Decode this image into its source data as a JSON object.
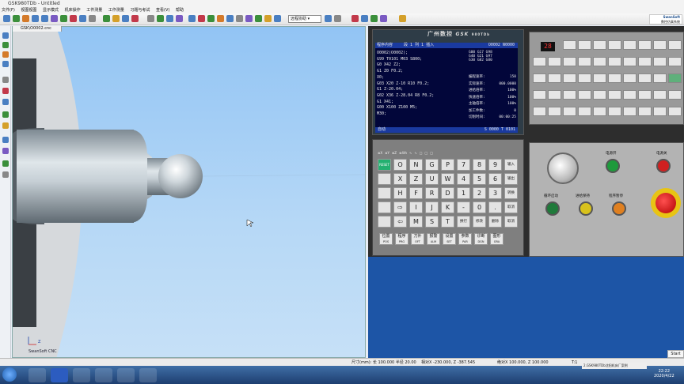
{
  "window": {
    "title": "GSK980TDb - Untitled"
  },
  "menu": [
    "文件(F)",
    "视图视图",
    "显示模式",
    "机床操作",
    "工件测量",
    "工作测量",
    "习题与考试",
    "查看(V)",
    "帮助"
  ],
  "toolbar": {
    "mode_select": "远程协助"
  },
  "viewport": {
    "tab_label": "GSK\\O0002.cnc",
    "watermark": "SwanSoft CNC",
    "axis_z": "Z",
    "axis_x": "X"
  },
  "cnc": {
    "brand_cn": "广州数控",
    "brand_en": "GSK",
    "model": "980TDb",
    "screen": {
      "header": "程序内容",
      "section": "段 1  列 1  插入",
      "program_no": "O0002 N0000",
      "lines": [
        "O0002(O0002);",
        "G99 T0101 M03 S800;",
        "G0 X42 Z2;",
        "G1 Z0 F0.2;",
        "X0;",
        "G03 X20 Z-10 R10 F0.2;",
        "G1 Z-20.04;",
        "G02 X36 Z-28.04 R8 F0.2;",
        "G1 X41;",
        "G00 X100 Z100 M5;",
        "M30;"
      ],
      "right_top": [
        "G00 G17 G98",
        "G40 G21 G97",
        "G30 G82 G80"
      ],
      "stats": [
        {
          "label": "编程速率:",
          "value": "150"
        },
        {
          "label": "实际速率:",
          "value": "000.0000"
        },
        {
          "label": "进给倍率:",
          "value": "100%"
        },
        {
          "label": "快速倍率:",
          "value": "100%"
        },
        {
          "label": "主轴倍率:",
          "value": "100%"
        },
        {
          "label": "加工件数:",
          "value": "0"
        },
        {
          "label": "切削时间:",
          "value": "00:00:25"
        }
      ],
      "footer_left": "自动",
      "footer_right": "S 0000   T 0101"
    },
    "axis_row": [
      "⊗X",
      "⊗Y",
      "⊗Z",
      "⊗4th",
      "∿",
      "∿",
      "□",
      "□",
      "□"
    ],
    "keys": [
      [
        "RESET",
        "O",
        "N",
        "G",
        "P",
        "7",
        "8",
        "9",
        "输入"
      ],
      [
        "",
        "X",
        "Z",
        "U",
        "W",
        "4",
        "5",
        "6",
        "输出"
      ],
      [
        "",
        "H",
        "F",
        "R",
        "D",
        "1",
        "2",
        "3",
        "转换"
      ],
      [
        "",
        "⇨",
        "I",
        "J",
        "K",
        "-",
        "0",
        ".",
        "取消"
      ],
      [
        "",
        "⇦",
        "M",
        "S",
        "T",
        "换行",
        "修改",
        "删除",
        "取消"
      ]
    ],
    "bottom_keys": [
      {
        "cn": "位置",
        "en": "POS"
      },
      {
        "cn": "程序",
        "en": "PRG"
      },
      {
        "cn": "刀补",
        "en": "OFT"
      },
      {
        "cn": "报警",
        "en": "ALM"
      },
      {
        "cn": "设置",
        "en": "SET"
      },
      {
        "cn": "参数",
        "en": "PAR"
      },
      {
        "cn": "诊断",
        "en": "DGN"
      },
      {
        "cn": "图形",
        "en": "GRA"
      }
    ],
    "machine": {
      "power_on": "电源开",
      "power_off": "电源关",
      "cycle_start": "循环启动",
      "feed_hold": "进给保持",
      "program_pause": "程序暂停"
    }
  },
  "right_panel": {
    "brand": "SwanSoft",
    "brand_cn": "数控仿真系统",
    "counter": "28"
  },
  "status": {
    "size": "尺寸(mm): 长 100.000 半径 20.00",
    "rel": "相对X -230.000, Z -387.545",
    "abs": "绝对X 100.000, Z 100.000",
    "tool": "T:1"
  },
  "taskbar": {
    "item": "2.GSK980TDb沈阳机床厂案例",
    "time": "22:22",
    "date": "2020/4/22",
    "start": "Start"
  }
}
